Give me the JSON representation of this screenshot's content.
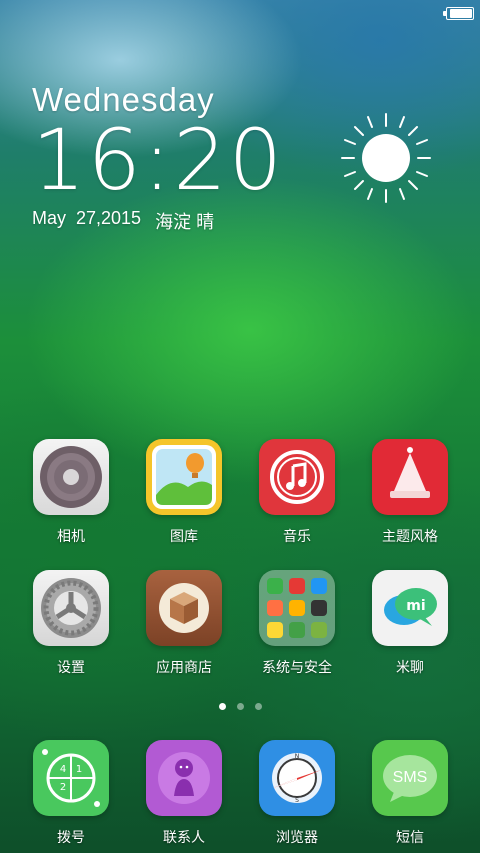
{
  "status_bar": {
    "battery_level": 1.0
  },
  "clock_widget": {
    "weekday": "Wednesday",
    "time": "16:20",
    "date": "May  27,2015",
    "location": "海淀",
    "weather": "晴",
    "weather_icon": "sun-icon"
  },
  "apps_row1": [
    {
      "label": "相机",
      "icon": "camera-icon"
    },
    {
      "label": "图库",
      "icon": "gallery-icon"
    },
    {
      "label": "音乐",
      "icon": "music-icon"
    },
    {
      "label": "主题风格",
      "icon": "theme-icon"
    }
  ],
  "apps_row2": [
    {
      "label": "设置",
      "icon": "settings-gear-icon"
    },
    {
      "label": "应用商店",
      "icon": "app-store-box-icon"
    },
    {
      "label": "系统与安全",
      "icon": "folder-icon"
    },
    {
      "label": "米聊",
      "icon": "miliao-chat-icon"
    }
  ],
  "page_indicator": {
    "pages": 3,
    "current": 1
  },
  "dock": [
    {
      "label": "拨号",
      "icon": "phone-dialer-icon"
    },
    {
      "label": "联系人",
      "icon": "contacts-icon"
    },
    {
      "label": "浏览器",
      "icon": "browser-compass-icon"
    },
    {
      "label": "短信",
      "icon": "sms-icon",
      "badge_text": "SMS"
    }
  ],
  "colors": {
    "music_red": "#e0363c",
    "theme_red": "#e12a36",
    "contacts_purple": "#b25ad3",
    "browser_blue": "#2f8fe4",
    "sms_green": "#57c84d",
    "dialer_green": "#49c85e"
  }
}
